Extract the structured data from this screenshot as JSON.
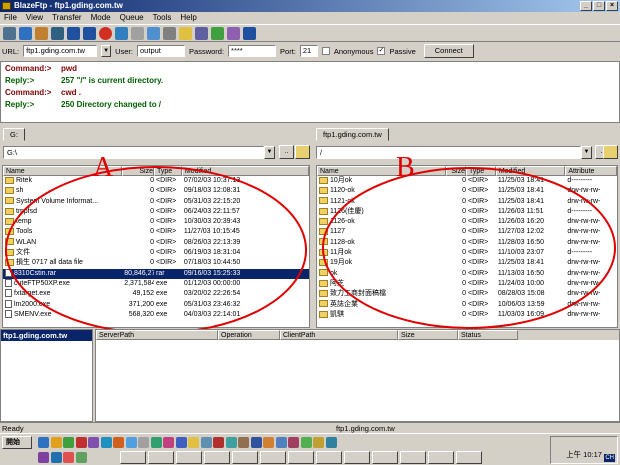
{
  "window": {
    "title": "BlazeFtp - ftp1.gding.com.tw"
  },
  "menu": [
    "File",
    "View",
    "Transfer",
    "Mode",
    "Queue",
    "Tools",
    "Help"
  ],
  "connect": {
    "url_label": "URL:",
    "url_value": "ftp1.gding.com.tw",
    "user_label": "User:",
    "user_value": "output",
    "password_label": "Password:",
    "password_value": "****",
    "port_label": "Port:",
    "port_value": "21",
    "anonymous_label": "Anonymous",
    "passive_label": "Passive",
    "passive_checked": "✓",
    "connect_button": "Connect"
  },
  "log": [
    {
      "kind": "Command:>",
      "text": "pwd"
    },
    {
      "kind": "Reply:>",
      "text": "257 \"/\" is current directory."
    },
    {
      "kind": "Command:>",
      "text": "cwd ."
    },
    {
      "kind": "Reply:>",
      "text": "250 Directory changed to /"
    }
  ],
  "left": {
    "tab": "G:",
    "path": "G:\\",
    "annotation": "A",
    "headers": [
      "Name",
      "Size",
      "Type",
      "Modified"
    ],
    "rows": [
      {
        "name": "Ritek",
        "size": "0",
        "type": "<DIR>",
        "mod": "07/02/03 10:37:13",
        "dir": true
      },
      {
        "name": "sh",
        "size": "0",
        "type": "<DIR>",
        "mod": "09/18/03 12:08:31",
        "dir": true
      },
      {
        "name": "System Volume Informat...",
        "size": "0",
        "type": "<DIR>",
        "mod": "05/31/03 22:15:20",
        "dir": true
      },
      {
        "name": "tmpfsd",
        "size": "0",
        "type": "<DIR>",
        "mod": "06/24/03 22:11:57",
        "dir": true
      },
      {
        "name": "temp",
        "size": "0",
        "type": "<DIR>",
        "mod": "10/30/03 20:39:43",
        "dir": true
      },
      {
        "name": "Tools",
        "size": "0",
        "type": "<DIR>",
        "mod": "11/27/03 10:15:45",
        "dir": true
      },
      {
        "name": "WLAN",
        "size": "0",
        "type": "<DIR>",
        "mod": "08/26/03 22:13:39",
        "dir": true
      },
      {
        "name": "文件",
        "size": "0",
        "type": "<DIR>",
        "mod": "06/19/03 18:31:04",
        "dir": true
      },
      {
        "name": "損生 0717 all data file",
        "size": "0",
        "type": "<DIR>",
        "mod": "07/18/03 10:44:50",
        "dir": true
      },
      {
        "name": "8310Cstin.rar",
        "size": "80,846,279",
        "type": "rar",
        "mod": "09/16/03 15:25:33",
        "dir": false,
        "selected": true
      },
      {
        "name": "cuteFTP50XP.exe",
        "size": "2,371,584",
        "type": "exe",
        "mod": "01/12/03 00:00:00",
        "dir": false
      },
      {
        "name": "fxtarget.exe",
        "size": "49,152",
        "type": "exe",
        "mod": "03/20/02 22:26:54",
        "dir": false
      },
      {
        "name": "lm2000.exe",
        "size": "371,200",
        "type": "exe",
        "mod": "05/31/03 23:46:32",
        "dir": false
      },
      {
        "name": "SMENV.exe",
        "size": "568,320",
        "type": "exe",
        "mod": "04/03/03 22:14:01",
        "dir": false
      }
    ]
  },
  "right": {
    "tab": "ftp1.gding.com.tw",
    "path": "/",
    "annotation": "B",
    "headers": [
      "Name",
      "Size",
      "Type",
      "Modified",
      "Attribute"
    ],
    "rows": [
      {
        "name": "10月ok",
        "size": "0",
        "type": "<DIR>",
        "mod": "11/25/03 18:41",
        "attr": "d---------"
      },
      {
        "name": "1120-ok",
        "size": "0",
        "type": "<DIR>",
        "mod": "11/25/03 18:41",
        "attr": "drw-rw-rw-"
      },
      {
        "name": "1121-ok",
        "size": "0",
        "type": "<DIR>",
        "mod": "11/25/03 18:41",
        "attr": "drw-rw-rw-"
      },
      {
        "name": "1126(佳慶)",
        "size": "0",
        "type": "<DIR>",
        "mod": "11/26/03 11:51",
        "attr": "d---------"
      },
      {
        "name": "1126-ok",
        "size": "0",
        "type": "<DIR>",
        "mod": "11/26/03 16:20",
        "attr": "drw-rw-rw-"
      },
      {
        "name": "1127",
        "size": "0",
        "type": "<DIR>",
        "mod": "11/27/03 12:02",
        "attr": "drw-rw-rw-"
      },
      {
        "name": "1128-ok",
        "size": "0",
        "type": "<DIR>",
        "mod": "11/28/03 16:50",
        "attr": "drw-rw-rw-"
      },
      {
        "name": "11月ok",
        "size": "0",
        "type": "<DIR>",
        "mod": "11/10/03 23:07",
        "attr": "d---------"
      },
      {
        "name": "19月ok",
        "size": "0",
        "type": "<DIR>",
        "mod": "11/25/03 18:41",
        "attr": "drw-rw-rw-"
      },
      {
        "name": "ok",
        "size": "0",
        "type": "<DIR>",
        "mod": "11/13/03 16:50",
        "attr": "drw-rw-rw-"
      },
      {
        "name": "阿芝",
        "size": "0",
        "type": "<DIR>",
        "mod": "11/24/03 10:00",
        "attr": "drw-rw-rw-"
      },
      {
        "name": "致力工商封面稿檔",
        "size": "0",
        "type": "<DIR>",
        "mod": "08/28/03 15:08",
        "attr": "drw-rw-rw-"
      },
      {
        "name": "英誌企業",
        "size": "0",
        "type": "<DIR>",
        "mod": "10/06/03 13:59",
        "attr": "drw-rw-rw-"
      },
      {
        "name": "凱騏",
        "size": "0",
        "type": "<DIR>",
        "mod": "11/03/03 16:09",
        "attr": "drw-rw-rw-"
      }
    ]
  },
  "queue": {
    "site": "ftp1.gding.com.tw",
    "headers": [
      "ServerPath",
      "Operation",
      "ClientPath",
      "Size",
      "Status"
    ]
  },
  "statusbar": {
    "left": "Ready",
    "center": "ftp1.gding.com.tw"
  },
  "taskbar": {
    "start": "開始",
    "clock": "上午 10:17",
    "lang": "CH"
  }
}
